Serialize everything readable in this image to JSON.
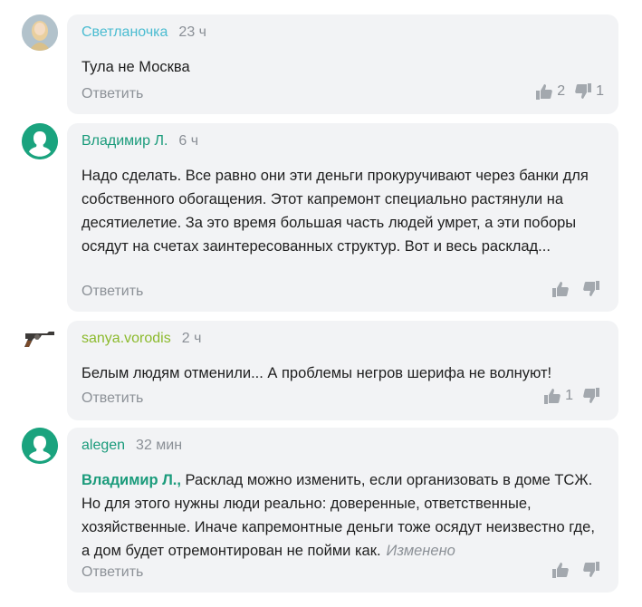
{
  "comments": [
    {
      "author": "Светланочка",
      "author_color": "#4bbcd1",
      "time": "23 ч",
      "text": "Тула не Москва",
      "reply_label": "Ответить",
      "likes": "2",
      "dislikes": "1"
    },
    {
      "author": "Владимир Л.",
      "author_color": "#1a9b7b",
      "time": "6 ч",
      "text": "Надо сделать. Все равно они эти деньги прокуручивают через банки для собственного обогащения. Этот капремонт специально растянули на десятиелетие. За это время большая часть людей умрет, а эти поборы осядут на счетах заинтересованных структур. Вот и весь расклад...",
      "reply_label": "Ответить",
      "likes": "",
      "dislikes": ""
    },
    {
      "author": "sanya.vorodis",
      "author_color": "#8cba2d",
      "time": "2 ч",
      "text": "Белым людям отменили... А проблемы негров шерифа не волнуют!",
      "reply_label": "Ответить",
      "likes": "1",
      "dislikes": ""
    },
    {
      "author": "alegen",
      "author_color": "#1a9b7b",
      "time": "32 мин",
      "mention": "Владимир Л.,",
      "text": " Расклад можно изменить, если организовать в доме ТСЖ. Но для этого нужны люди реально: доверенные, ответственные, хозяйственные. Иначе капремонтные деньги тоже осядут неизвестно где, а дом будет отремонтирован не пойми как.",
      "edited_label": "Изменено",
      "reply_label": "Ответить",
      "likes": "",
      "dislikes": ""
    }
  ],
  "icons": {
    "like": "thumbs-up-icon",
    "dislike": "thumbs-down-icon"
  },
  "colors": {
    "bubble_bg": "#f2f3f5",
    "muted": "#8c9197",
    "green_avatar": "#1aa37e"
  }
}
